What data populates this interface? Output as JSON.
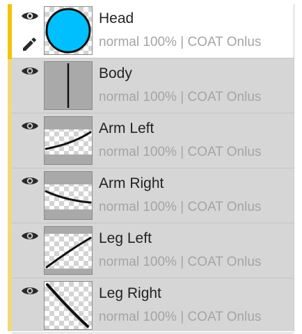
{
  "layers": [
    {
      "name": "Head",
      "mode": "normal",
      "opacity": "100%",
      "separator": "|",
      "owner": "COAT Onlus",
      "thumbnail": "blue-circle",
      "active": true,
      "visible": true,
      "editing": true
    },
    {
      "name": "Body",
      "mode": "normal",
      "opacity": "100%",
      "separator": "|",
      "owner": "COAT Onlus",
      "thumbnail": "vertical-line",
      "active": false,
      "visible": true
    },
    {
      "name": "Arm Left",
      "mode": "normal",
      "opacity": "100%",
      "separator": "|",
      "owner": "COAT Onlus",
      "thumbnail": "curve-up",
      "active": false,
      "visible": true
    },
    {
      "name": "Arm Right",
      "mode": "normal",
      "opacity": "100%",
      "separator": "|",
      "owner": "COAT Onlus",
      "thumbnail": "curve-down",
      "active": false,
      "visible": true
    },
    {
      "name": "Leg Left",
      "mode": "normal",
      "opacity": "100%",
      "separator": "|",
      "owner": "COAT Onlus",
      "thumbnail": "diagonal-up",
      "active": false,
      "visible": true
    },
    {
      "name": "Leg Right",
      "mode": "normal",
      "opacity": "100%",
      "separator": "|",
      "owner": "COAT Onlus",
      "thumbnail": "diagonal-down",
      "active": false,
      "visible": true
    }
  ],
  "icons": {
    "visibility": "eye-icon",
    "edit": "pencil-icon"
  },
  "colors": {
    "accent_active": "#f1c400",
    "accent": "#f1d97a",
    "panel": "#d6d6d6",
    "head_fill": "#00bfff",
    "meta_text": "#a4a4a4"
  }
}
